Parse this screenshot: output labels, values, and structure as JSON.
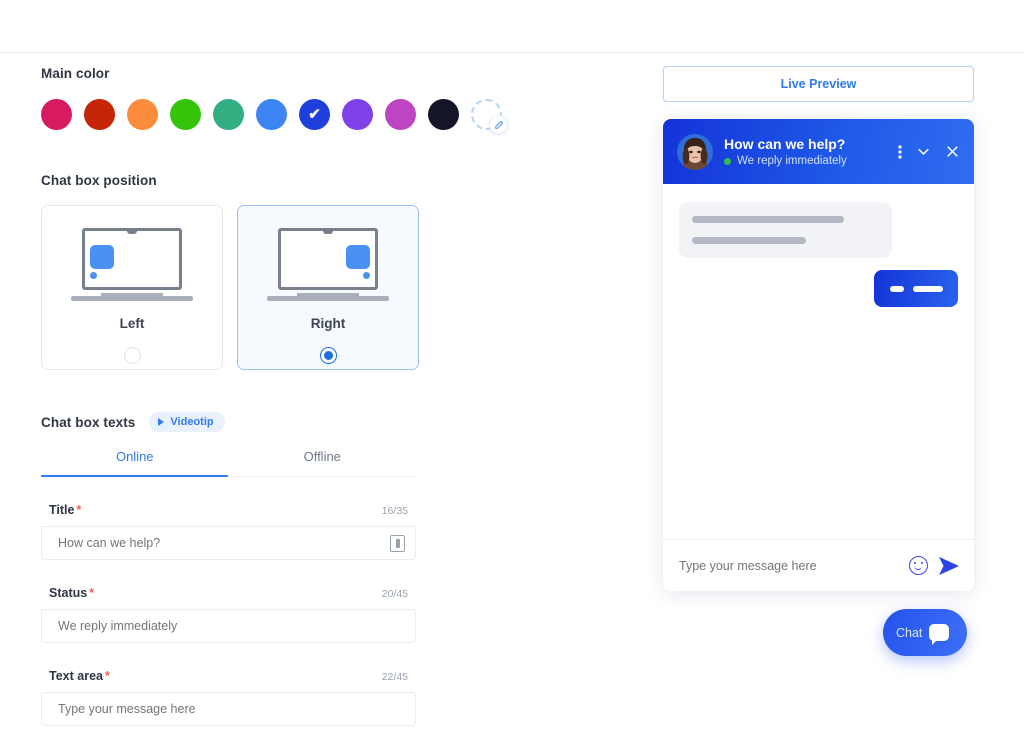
{
  "main_color": {
    "label": "Main color",
    "swatches": [
      {
        "name": "pink",
        "hex": "#d81b60"
      },
      {
        "name": "dark-red",
        "hex": "#c62608"
      },
      {
        "name": "orange",
        "hex": "#fb8c3c"
      },
      {
        "name": "green",
        "hex": "#34c50a"
      },
      {
        "name": "teal-green",
        "hex": "#33ae80"
      },
      {
        "name": "light-blue",
        "hex": "#3d85f5"
      },
      {
        "name": "blue",
        "hex": "#1e3fdb"
      },
      {
        "name": "purple",
        "hex": "#8040e8"
      },
      {
        "name": "magenta",
        "hex": "#bd45c4"
      },
      {
        "name": "near-black",
        "hex": "#141627"
      }
    ],
    "selected_index": 6,
    "selected_tick": "✔",
    "custom_picker_icon": "pencil-icon"
  },
  "chat_box_position": {
    "label": "Chat box position",
    "options": [
      {
        "name": "left",
        "label": "Left",
        "selected": false
      },
      {
        "name": "right",
        "label": "Right",
        "selected": true
      }
    ]
  },
  "chat_box_texts": {
    "label": "Chat box texts",
    "videotip_label": "Videotip",
    "videotip_icon": "play-icon",
    "tabs": [
      {
        "label": "Online",
        "active": true
      },
      {
        "label": "Offline",
        "active": false
      }
    ],
    "fields": [
      {
        "name": "title",
        "label": "Title",
        "required_marker": "*",
        "counter": "16/35",
        "value": "How can we help?",
        "placeholder": "How can we help?",
        "trailing_icon": "device-icon"
      },
      {
        "name": "status",
        "label": "Status",
        "required_marker": "*",
        "counter": "20/45",
        "value": "We reply immediately",
        "placeholder": "We reply immediately",
        "trailing_icon": null
      },
      {
        "name": "text-area",
        "label": "Text area",
        "required_marker": "*",
        "counter": "22/45",
        "value": "Type your message here",
        "placeholder": "Type your message here",
        "trailing_icon": null
      }
    ]
  },
  "preview": {
    "live_preview_label": "Live Preview",
    "widget": {
      "title": "How can we help?",
      "status": "We reply immediately",
      "status_dot_color": "#33c14b",
      "header_gradient_from": "#1433d8",
      "header_gradient_to": "#2f6df0",
      "avatar_name": "agent-avatar",
      "actions": [
        {
          "name": "more-options-icon",
          "glyph": "⋮"
        },
        {
          "name": "chevron-down-icon",
          "glyph": "⌄"
        },
        {
          "name": "close-icon",
          "glyph": "✕"
        }
      ],
      "input_placeholder": "Type your message here",
      "emoji_icon": "emoji-icon",
      "send_icon": "send-icon"
    },
    "fab": {
      "label": "Chat",
      "icon": "chat-bubble-icon"
    }
  }
}
